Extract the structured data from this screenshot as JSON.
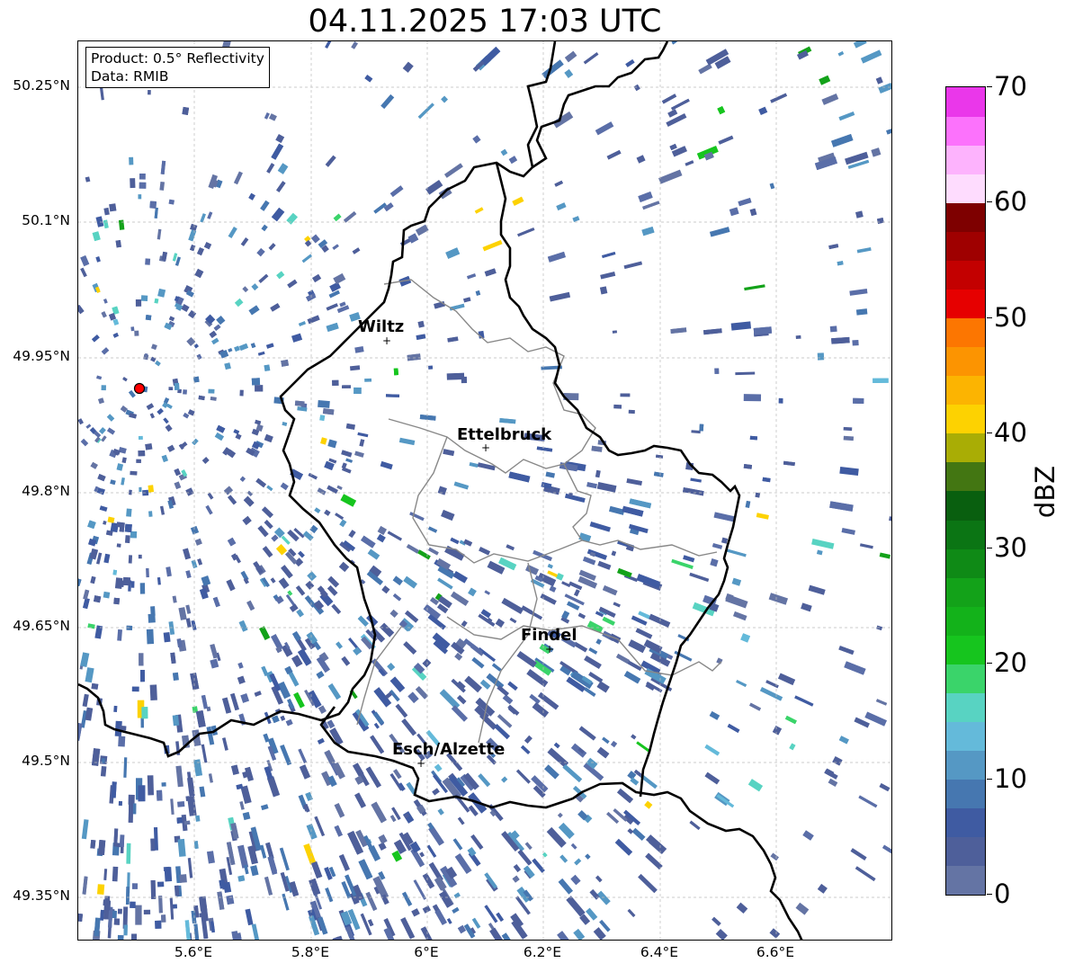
{
  "title": "04.11.2025 17:03 UTC",
  "info": {
    "line1": "Product: 0.5° Reflectivity",
    "line2": "Data: RMIB"
  },
  "lat_ticks": [
    "50.25°N",
    "50.1°N",
    "49.95°N",
    "49.8°N",
    "49.65°N",
    "49.5°N",
    "49.35°N"
  ],
  "lon_ticks": [
    "5.6°E",
    "5.8°E",
    "6°E",
    "6.2°E",
    "6.4°E",
    "6.6°E"
  ],
  "cities": [
    {
      "name": "Wiltz"
    },
    {
      "name": "Ettelbruck"
    },
    {
      "name": "Findel"
    },
    {
      "name": "Esch/Alzette"
    }
  ],
  "colorbar": {
    "unit": "dBZ",
    "min": 0,
    "max": 70,
    "step": 2.5,
    "tick_labels": [
      "0",
      "10",
      "20",
      "30",
      "40",
      "50",
      "60",
      "70"
    ],
    "colors": [
      "#6474a4",
      "#4e5f9a",
      "#3f5ba2",
      "#4677b0",
      "#5598c4",
      "#64bada",
      "#58d3c2",
      "#3ad46a",
      "#16c51e",
      "#13b21a",
      "#13a219",
      "#0f8a16",
      "#0b7514",
      "#095f0f",
      "#437612",
      "#a9ad05",
      "#fdd201",
      "#fcb401",
      "#fc9401",
      "#fc7601",
      "#e60000",
      "#c30000",
      "#9f0000",
      "#7e0000",
      "#fedcfe",
      "#fdb3fd",
      "#fc72fc",
      "#ea37ea"
    ]
  },
  "radar_site": {
    "color": "#ff0000"
  },
  "colors": {
    "border": "#000000",
    "canton_lines": "#888888",
    "grid": "#bbbbbb"
  }
}
